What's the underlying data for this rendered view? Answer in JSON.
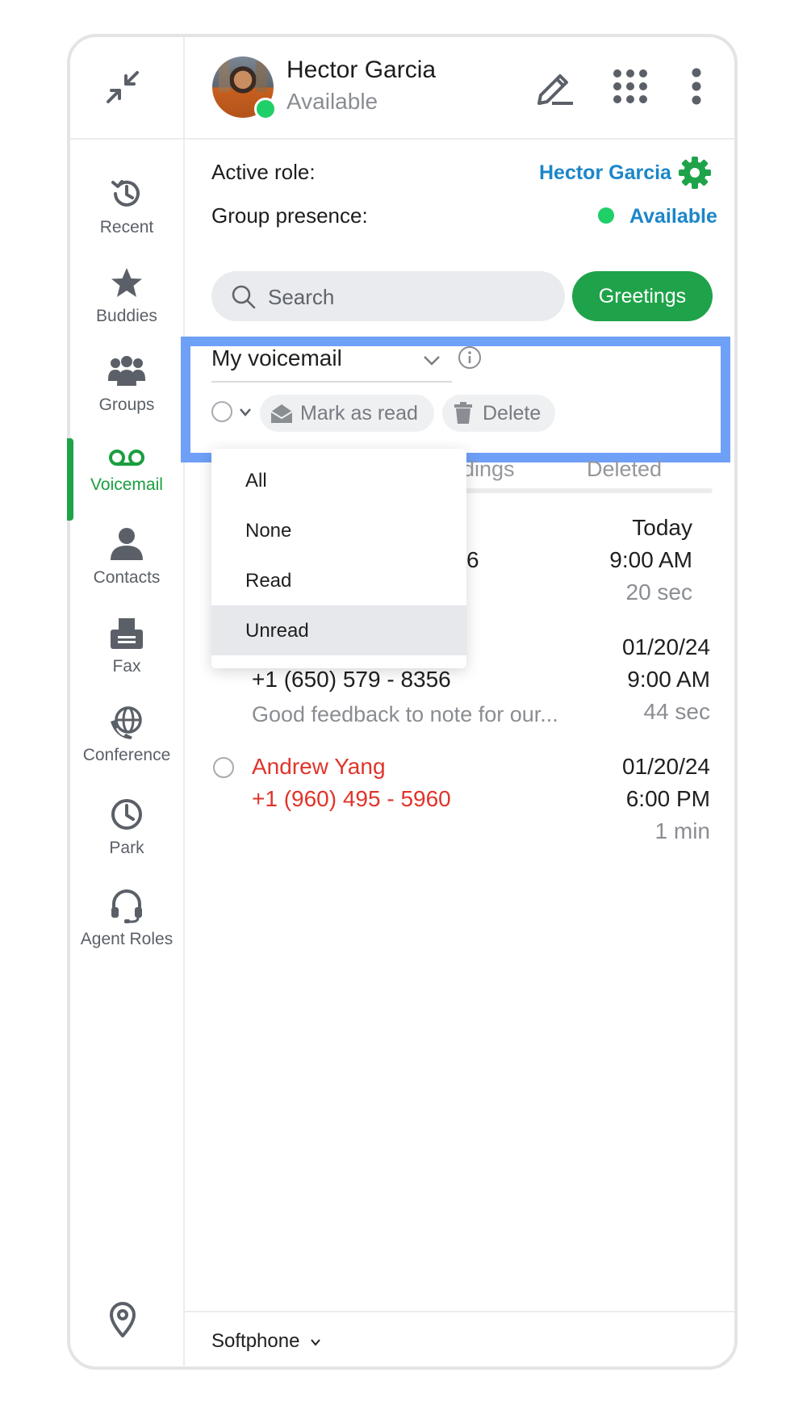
{
  "header": {
    "user_name": "Hector Garcia",
    "user_status": "Available"
  },
  "colors": {
    "accent_green": "#1fa34a",
    "link_blue": "#1b86c9",
    "missed_red": "#e0342a",
    "highlight_blue": "#6ea0f7",
    "presence_green": "#1fcf68"
  },
  "icons": [
    "minimize-icon",
    "edit-icon",
    "dialpad-icon",
    "more-vertical-icon",
    "gear-icon",
    "search-icon",
    "chevron-down-icon",
    "info-icon",
    "envelope-open-icon",
    "trash-icon",
    "location-pin-icon"
  ],
  "sidebar": {
    "items": [
      {
        "label": "Recent"
      },
      {
        "label": "Buddies"
      },
      {
        "label": "Groups"
      },
      {
        "label": "Voicemail"
      },
      {
        "label": "Contacts"
      },
      {
        "label": "Fax"
      },
      {
        "label": "Conference"
      },
      {
        "label": "Park"
      },
      {
        "label": "Agent Roles"
      }
    ],
    "active": "Voicemail"
  },
  "role": {
    "active_role_label": "Active role:",
    "active_role_value": "Hector Garcia",
    "group_presence_label": "Group presence:",
    "group_presence_value": "Available"
  },
  "search": {
    "placeholder": "Search"
  },
  "greetings_label": "Greetings",
  "voicemail_select": {
    "value": "My voicemail"
  },
  "toolbar": {
    "mark_read_label": "Mark as read",
    "delete_label": "Delete"
  },
  "tabs": {
    "partial_label": "dings",
    "deleted_label": "Deleted"
  },
  "dropdown": {
    "options": [
      "All",
      "None",
      "Read",
      "Unread"
    ],
    "hovered": "Unread"
  },
  "voicemails": [
    {
      "number_fragment": "6",
      "date": "Today",
      "time": "9:00 AM",
      "duration": "20 sec"
    },
    {
      "number": "+1 (650) 579 - 8356",
      "preview": "Good feedback to note for our...",
      "date": "01/20/24",
      "time": "9:00 AM",
      "duration": "44 sec"
    },
    {
      "name": "Andrew Yang",
      "number": "+1 (960) 495 - 5960",
      "date": "01/20/24",
      "time": "6:00 PM",
      "duration": "1 min"
    }
  ],
  "footer": {
    "mode_label": "Softphone"
  }
}
